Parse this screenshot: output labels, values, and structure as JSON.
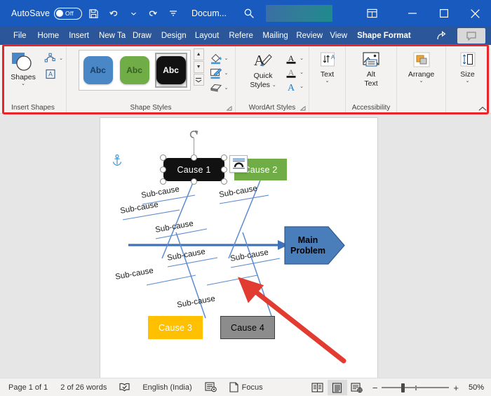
{
  "titlebar": {
    "autosave_label": "AutoSave",
    "autosave_state": "Off",
    "save_icon": "save-icon",
    "undo_icon": "undo-icon",
    "redo_icon": "redo-icon",
    "customize_icon": "customize-quick-access-icon",
    "document_name": "Docum...",
    "search_icon": "search-icon",
    "ribbon_display_icon": "ribbon-display-options-icon",
    "minimize_icon": "minimize-icon",
    "maximize_icon": "maximize-icon",
    "close_icon": "close-icon"
  },
  "tabs": [
    {
      "label": "File",
      "active": false
    },
    {
      "label": "Home",
      "active": false
    },
    {
      "label": "Insert",
      "active": false
    },
    {
      "label": "New Ta",
      "active": false
    },
    {
      "label": "Draw",
      "active": false
    },
    {
      "label": "Design",
      "active": false
    },
    {
      "label": "Layout",
      "active": false
    },
    {
      "label": "Refere",
      "active": false
    },
    {
      "label": "Mailing",
      "active": false
    },
    {
      "label": "Review",
      "active": false
    },
    {
      "label": "View",
      "active": false
    },
    {
      "label": "Shape Format",
      "active": true
    }
  ],
  "tab_right": {
    "share_icon": "share-icon",
    "comments_icon": "comments-icon"
  },
  "ribbon": {
    "highlight_color": "#e8252a",
    "collapse_icon": "collapse-ribbon-icon",
    "groups": [
      {
        "name": "Insert Shapes",
        "label": "Insert Shapes",
        "shapes_button": {
          "label": "Shapes",
          "caret": "⌄",
          "icon": "shapes-icon"
        },
        "edit_shape": {
          "icon": "edit-shape-icon",
          "caret": "⌄"
        },
        "text_box": {
          "icon": "draw-text-box-icon"
        }
      },
      {
        "name": "Shape Styles",
        "label": "Shape Styles",
        "gallery": [
          {
            "text": "Abc",
            "style": "blue",
            "selected": false
          },
          {
            "text": "Abc",
            "style": "green",
            "selected": false
          },
          {
            "text": "Abc",
            "style": "black",
            "selected": true
          }
        ],
        "scroll_up": "▲",
        "scroll_down": "▼",
        "scroll_more": "▼",
        "shape_fill": {
          "icon": "shape-fill-icon",
          "caret": "⌄"
        },
        "shape_outline": {
          "icon": "shape-outline-icon",
          "caret": "⌄"
        },
        "shape_effects": {
          "icon": "shape-effects-icon",
          "caret": "⌄"
        },
        "dialog_launcher": "◱"
      },
      {
        "name": "WordArt Styles",
        "label": "WordArt Styles",
        "quick_styles": {
          "label_line1": "Quick",
          "label_line2": "Styles",
          "caret": "⌄",
          "icon": "wordart-quick-styles-icon"
        },
        "text_fill": {
          "icon": "text-fill-icon",
          "caret": "⌄"
        },
        "text_outline": {
          "icon": "text-outline-icon",
          "caret": "⌄"
        },
        "text_effects": {
          "icon": "text-effects-icon",
          "caret": "⌄"
        },
        "dialog_launcher": "◱"
      },
      {
        "name": "Text",
        "label": "",
        "text_button": {
          "label": "Text",
          "caret": "⌄",
          "icon": "text-direction-icon"
        }
      },
      {
        "name": "Accessibility",
        "label": "Accessibility",
        "alt_text_button": {
          "label_line1": "Alt",
          "label_line2": "Text",
          "icon": "alt-text-icon"
        }
      },
      {
        "name": "Arrange",
        "label": "",
        "arrange_button": {
          "label": "Arrange",
          "caret": "⌄",
          "icon": "arrange-icon"
        }
      },
      {
        "name": "Size",
        "label": "",
        "size_button": {
          "label": "Size",
          "caret": "⌄",
          "icon": "size-icon"
        }
      }
    ]
  },
  "document": {
    "anchor_icon": "object-anchor-icon",
    "layout_options_icon": "layout-options-icon",
    "rotate_handle_icon": "rotate-handle-icon",
    "red_annotation_arrow": "red-annotation-arrow",
    "diagram": {
      "type": "fishbone-ishikawa",
      "spine_color": "#3f72b8",
      "main_problem": {
        "line1": "Main",
        "line2": "Problem",
        "fill": "#4a7ebb",
        "outline": "#2e5b8f"
      },
      "causes": [
        {
          "label": "Cause 1",
          "fill": "#111111",
          "text_color": "#ffffff",
          "selected": true
        },
        {
          "label": "Cause 2",
          "fill": "#70ad47",
          "text_color": "#ffffff",
          "selected": false
        },
        {
          "label": "Cause 3",
          "fill": "#ffc000",
          "text_color": "#ffffff",
          "selected": false
        },
        {
          "label": "Cause 4",
          "fill": "#8c8c8c",
          "text_color": "#000000",
          "selected": false
        }
      ],
      "sub_causes": [
        "Sub-cause",
        "Sub-cause",
        "Sub-cause",
        "Sub-cause",
        "Sub-cause",
        "Sub-cause",
        "Sub-cause",
        "Sub-cause"
      ]
    }
  },
  "statusbar": {
    "page": "Page 1 of 1",
    "words": "2 of 26 words",
    "proofing_icon": "proofing-errors-icon",
    "language": "English (India)",
    "accessibility_icon": "accessibility-checker-icon",
    "focus_icon": "focus-mode-icon",
    "focus_label": "Focus",
    "read_mode_icon": "read-mode-icon",
    "print_layout_icon": "print-layout-icon",
    "web_layout_icon": "web-layout-icon",
    "zoom_out": "−",
    "zoom_in": "+",
    "zoom_level": "50%"
  }
}
